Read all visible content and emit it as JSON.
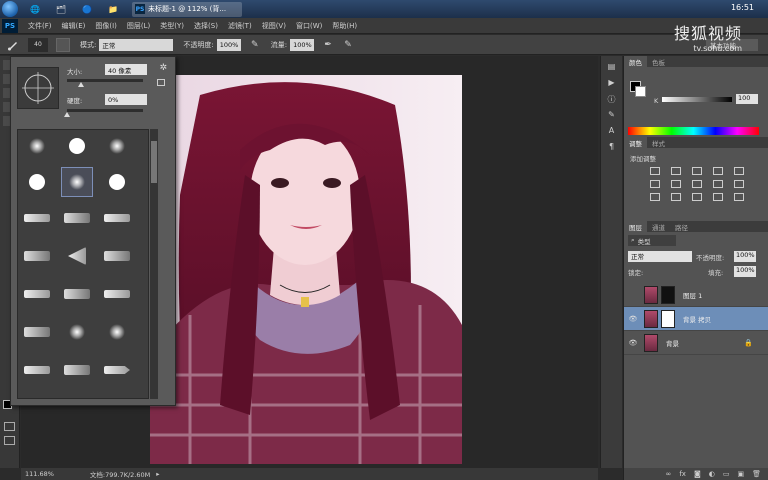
{
  "taskbar": {
    "task_label": "未标题-1 @ 112% (背...",
    "ps_badge": "PS",
    "clock": "16:51"
  },
  "menubar": {
    "logo": "PS",
    "items": [
      "文件(F)",
      "编辑(E)",
      "图像(I)",
      "图层(L)",
      "类型(Y)",
      "选择(S)",
      "滤镜(T)",
      "视图(V)",
      "窗口(W)",
      "帮助(H)"
    ]
  },
  "watermark": {
    "title": "搜狐视频",
    "url": "tv.sohu.com"
  },
  "options_bar": {
    "brush_size": "40",
    "mode_label": "模式:",
    "mode_value": "正常",
    "opacity_label": "不透明度:",
    "opacity_value": "100%",
    "flow_label": "流量:",
    "flow_value": "100%",
    "workspace": "基本功能"
  },
  "brush_picker": {
    "size_label": "大小:",
    "size_value": "40 像素",
    "hardness_label": "硬度:",
    "hardness_value": "0%",
    "size_slider": 0.1,
    "hardness_slider": 0.0
  },
  "status_bar": {
    "zoom": "111.68%",
    "doc_info": "文档:799.7K/2.60M"
  },
  "color_panel": {
    "tabs": [
      "颜色",
      "色板"
    ],
    "channel_label": "K",
    "channel_value": "100",
    "foreground": "#000000",
    "background": "#ffffff"
  },
  "adjustments_panel": {
    "tabs": [
      "调整",
      "样式"
    ],
    "heading": "添加调整"
  },
  "layers_panel": {
    "tabs": [
      "图层",
      "通道",
      "路径"
    ],
    "filter_label": "类型",
    "blend_mode": "正常",
    "opacity_label": "不透明度:",
    "opacity_value": "100%",
    "lock_label": "锁定:",
    "fill_label": "填充:",
    "fill_value": "100%",
    "layers": [
      {
        "name": "图层 1",
        "selected": false,
        "visible": false
      },
      {
        "name": "背景 拷贝",
        "selected": true,
        "visible": true
      },
      {
        "name": "背景",
        "selected": false,
        "visible": true
      }
    ]
  }
}
